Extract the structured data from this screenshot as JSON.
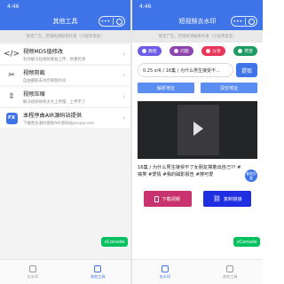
{
  "left": {
    "status_time": "4:46",
    "title": "其他工具",
    "notice": "暂无广告，若侵权请联系作者（小程序直连）",
    "tools": [
      {
        "icon": "code-icon",
        "glyph": "</>",
        "title": "视频MD5值修改",
        "desc": "有效解决短视频重复上传、防重检测"
      },
      {
        "icon": "scissors-icon",
        "glyph": "✂",
        "title": "视频剪裁",
        "desc": "自由截取去水印视频片段"
      },
      {
        "icon": "compress-icon",
        "glyph": "⇳",
        "title": "视频压缩",
        "desc": "解决视频体积太大上传慢、上传不了"
      },
      {
        "icon": "fx-logo-icon",
        "glyph": "FX",
        "title": "本程序由AIR源码站提供",
        "desc": "下载更多源码搜索AIR源码站airsyw.com"
      }
    ],
    "console": "vConsole",
    "tabs": [
      "去水印",
      "其他工具"
    ]
  },
  "right": {
    "status_time": "4:46",
    "title": "短视频去水印",
    "notice": "暂无广告，若侵权请联系作者（小程序直连）",
    "pills": [
      {
        "label": "教程",
        "color": "#6c5ce7"
      },
      {
        "label": "问题",
        "color": "#8e44ad"
      },
      {
        "label": "分享",
        "color": "#e8365a"
      },
      {
        "label": "赞赏",
        "color": "#1e9b62"
      }
    ],
    "url_value": "0.25 srR / 16集 / 为什么男生接受不...",
    "parse_label": "提取",
    "btn_parse_addr": "解析地址",
    "btn_clear_addr": "清空地址",
    "description": "16集 / 为什么男生接受不了女朋友撑着出自己?? #搞笑 #爱情 #我的磁影报告 #撩可爱",
    "copy_text": "复制文案",
    "download_label": "下载视频",
    "copy_link_label": "复制链接",
    "console": "vConsole",
    "tabs": [
      "去水印",
      "其他工具"
    ]
  }
}
